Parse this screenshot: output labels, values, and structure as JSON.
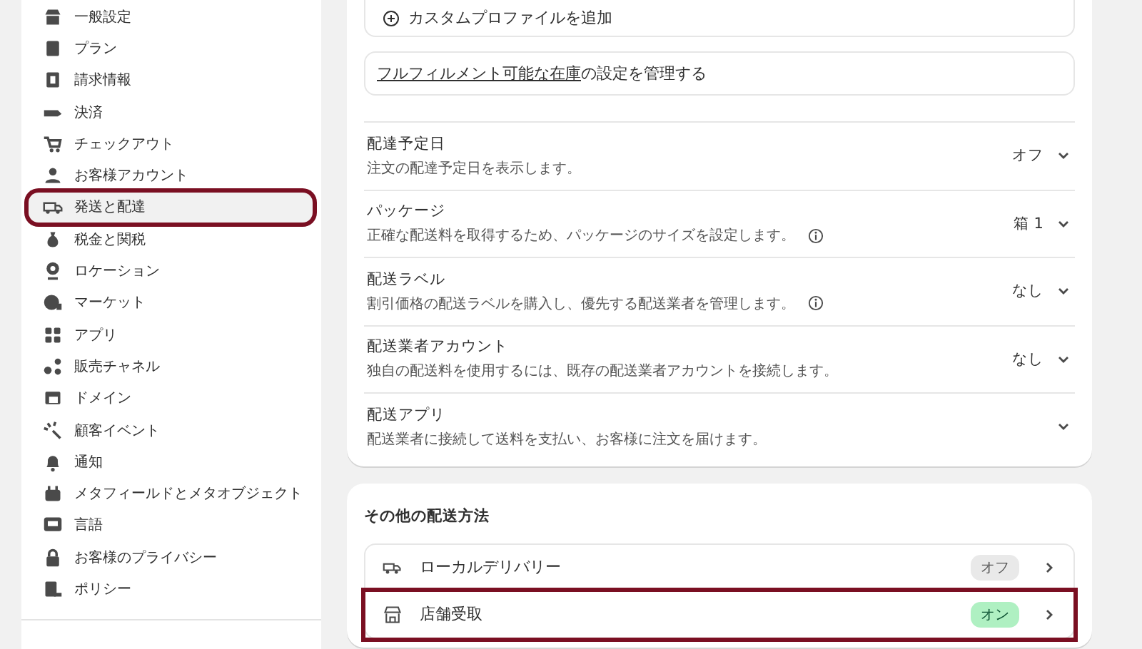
{
  "sidebar": {
    "items": [
      {
        "label": "一般設定",
        "selected": false,
        "highlighted": false
      },
      {
        "label": "プラン",
        "selected": false,
        "highlighted": false
      },
      {
        "label": "請求情報",
        "selected": false,
        "highlighted": false
      },
      {
        "label": "決済",
        "selected": false,
        "highlighted": false
      },
      {
        "label": "チェックアウト",
        "selected": false,
        "highlighted": false
      },
      {
        "label": "お客様アカウント",
        "selected": false,
        "highlighted": false
      },
      {
        "label": "発送と配達",
        "selected": true,
        "highlighted": true
      },
      {
        "label": "税金と関税",
        "selected": false,
        "highlighted": false
      },
      {
        "label": "ロケーション",
        "selected": false,
        "highlighted": false
      },
      {
        "label": "マーケット",
        "selected": false,
        "highlighted": false
      },
      {
        "label": "アプリ",
        "selected": false,
        "highlighted": false
      },
      {
        "label": "販売チャネル",
        "selected": false,
        "highlighted": false
      },
      {
        "label": "ドメイン",
        "selected": false,
        "highlighted": false
      },
      {
        "label": "顧客イベント",
        "selected": false,
        "highlighted": false
      },
      {
        "label": "通知",
        "selected": false,
        "highlighted": false
      },
      {
        "label": "メタフィールドとメタオブジェクト",
        "selected": false,
        "highlighted": false
      },
      {
        "label": "言語",
        "selected": false,
        "highlighted": false
      },
      {
        "label": "お客様のプライバシー",
        "selected": false,
        "highlighted": false
      },
      {
        "label": "ポリシー",
        "selected": false,
        "highlighted": false
      }
    ]
  },
  "shipping": {
    "add_profile": "カスタムプロファイルを追加",
    "fulfillment": {
      "link": "フルフィルメント可能な在庫",
      "text": "の設定を管理する"
    },
    "rows": [
      {
        "title": "配達予定日",
        "description": "注文の配達予定日を表示します。",
        "info": false,
        "value": "オフ"
      },
      {
        "title": "パッケージ",
        "description": "正確な配送料を取得するため、パッケージのサイズを設定します。",
        "info": true,
        "value": "箱 1"
      },
      {
        "title": "配送ラベル",
        "description": "割引価格の配送ラベルを購入し、優先する配送業者を管理します。",
        "info": true,
        "value": "なし"
      },
      {
        "title": "配送業者アカウント",
        "description": "独自の配送料を使用するには、既存の配送業者アカウントを接続します。",
        "info": false,
        "value": "なし"
      },
      {
        "title": "配送アプリ",
        "description": "配送業者に接続して送料を支払い、お客様に注文を届けます。",
        "info": false
      }
    ]
  },
  "other_methods": {
    "title": "その他の配送方法",
    "items": [
      {
        "label": "ローカルデリバリー",
        "badge": "オフ",
        "on": false,
        "highlighted": false
      },
      {
        "label": "店舗受取",
        "badge": "オン",
        "on": true,
        "highlighted": true
      }
    ]
  }
}
